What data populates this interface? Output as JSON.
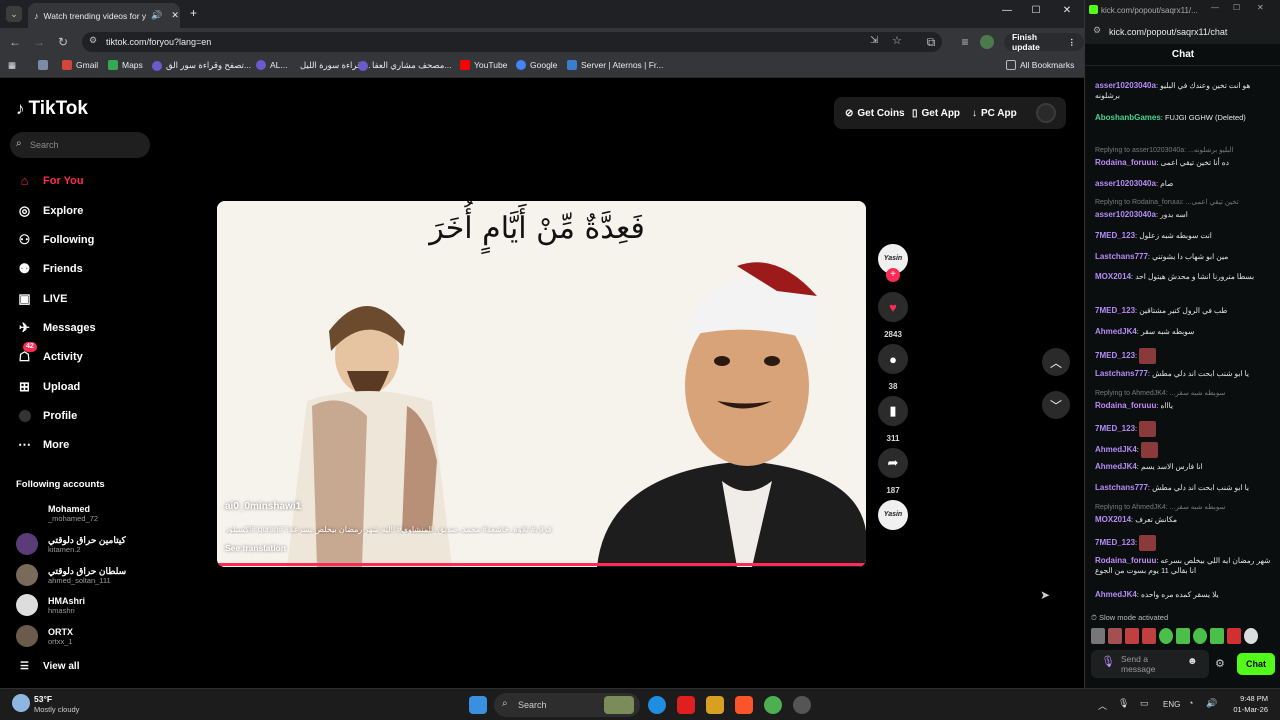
{
  "left_window": {
    "tab_title": "Watch trending videos for y",
    "url": "tiktok.com/foryou?lang=en",
    "finish_update": "Finish update",
    "bookmarks": [
      "Gmail",
      "Maps",
      "تصفح وقراءة سور الق...",
      "AL...",
      "قراءة سورة الليل ...",
      "مصحف مشاري العفا...",
      "YouTube",
      "Google",
      "Server | Aternos | Fr..."
    ],
    "all_bookmarks": "All Bookmarks"
  },
  "tiktok": {
    "logo": "TikTok",
    "search_placeholder": "Search",
    "nav": [
      "For You",
      "Explore",
      "Following",
      "Friends",
      "LIVE",
      "Messages",
      "Activity",
      "Upload",
      "Profile",
      "More"
    ],
    "activity_badge": "42",
    "following_accounts_label": "Following accounts",
    "accounts": [
      {
        "name": "Mohamed",
        "handle": "_mohamed_72"
      },
      {
        "name": "كيتامين حراق دلوقتي",
        "handle": "kitamen.2"
      },
      {
        "name": "سلطان حراق دلوقتي",
        "handle": "ahmed_soltan_111"
      },
      {
        "name": "HMAshri",
        "handle": "hmashri"
      },
      {
        "name": "ORTX",
        "handle": "ortxx_1"
      }
    ],
    "view_all": "View all",
    "top_buttons": [
      "Get Coins",
      "Get App",
      "PC App"
    ],
    "video": {
      "arabic_title": "فَعِدَّةٌ مِّنْ أَيَّامٍ أُخَرَ",
      "author": "ai0_0minshawi1",
      "caption": "اكسبلور# quran# قرآن# تلاوة_خاشعة# محمد_صديق_المنشاوي# !!ليه شهر رمضان بيخلص بسرعة؟",
      "see_translation": "See translation"
    },
    "rail": {
      "likes": "2843",
      "comments": "38",
      "saves": "311",
      "shares": "187",
      "avatar_label": "Yasin"
    }
  },
  "chat_window": {
    "url_top": "kick.com/popout/saqrx11/...",
    "url": "kick.com/popout/saqrx11/chat",
    "header": "Chat",
    "messages": [
      {
        "user": "asser10203040a",
        "text": "هو انت تخين وعندك في البليو برشلونه",
        "color": "#b58cf6"
      },
      {
        "user": "AboshanbGames",
        "text": "FUJGI GGHW (Deleted)",
        "color": "#4ad395"
      },
      {
        "reply": "Replying to asser10203040a: ...البليو برشلونه"
      },
      {
        "user": "Rodaina_foruuu",
        "text": "ده أنا تخين تيقي اعمى",
        "color": "#c08cf7"
      },
      {
        "user": "asser10203040a",
        "text": "صام",
        "color": "#b58cf6"
      },
      {
        "reply": "Replying to Rodaina_foruuu: ...تخين تيقي اعمى"
      },
      {
        "user": "asser10203040a",
        "text": "اسه بدور",
        "color": "#b58cf6"
      },
      {
        "user": "7MED_123",
        "text": "انت سوبطه شبه زعلول",
        "color": "#b58cf6"
      },
      {
        "user": "Lastchans777",
        "text": "مين ابو شهاب دا يشوتني",
        "color": "#b58cf6"
      },
      {
        "user": "MOX2014",
        "text": "بسطا مترورنا انشا و محدش هيتول احد",
        "color": "#b58cf6"
      },
      {
        "user": "7MED_123",
        "text": "طب في الرول كتير مشتاقين",
        "color": "#b58cf6"
      },
      {
        "user": "AhmedJK4",
        "text": "سوبطه شبه سقر",
        "color": "#b58cf6"
      },
      {
        "user": "7MED_123",
        "text": "",
        "color": "#b58cf6"
      },
      {
        "user": "Lastchans777",
        "text": "يا ابو شنب ابحت اند دلي مطش",
        "color": "#b58cf6"
      },
      {
        "reply": "Replying to AhmedJK4: ...سوبطه شبه سقر"
      },
      {
        "user": "Rodaina_foruuu",
        "text": "ياااه",
        "color": "#c08cf7"
      },
      {
        "user": "7MED_123",
        "text": "",
        "color": "#b58cf6"
      },
      {
        "user": "AhmedJK4",
        "text": "",
        "color": "#b58cf6"
      },
      {
        "user": "AhmedJK4",
        "text": "انا فارس الاسد يسم",
        "color": "#b58cf6"
      },
      {
        "user": "Lastchans777",
        "text": "يا ابو شنب ابحت اند دلي مطش",
        "color": "#b58cf6"
      },
      {
        "reply": "Replying to AhmedJK4: ...سوبطه شبه سقر"
      },
      {
        "user": "MOX2014",
        "text": "مكانش تعرف",
        "color": "#b58cf6"
      },
      {
        "user": "7MED_123",
        "text": "",
        "color": "#b58cf6"
      },
      {
        "user": "Rodaina_foruuu",
        "text": "شهر رمضان ايه اللي بيخلص بسرعه انا بقالي 11 يوم بسوت من الجوع",
        "color": "#c08cf7"
      },
      {
        "user": "AhmedJK4",
        "text": "يلا يسقر كمده مره واحده",
        "color": "#b58cf6"
      }
    ],
    "slow_mode": "Slow mode activated",
    "send_placeholder": "Send a message",
    "chat_button": "Chat"
  },
  "taskbar": {
    "temp": "53°F",
    "weather": "Mostly cloudy",
    "search": "Search",
    "lang": "ENG",
    "time": "9:48 PM",
    "date": "01-Mar-26"
  }
}
